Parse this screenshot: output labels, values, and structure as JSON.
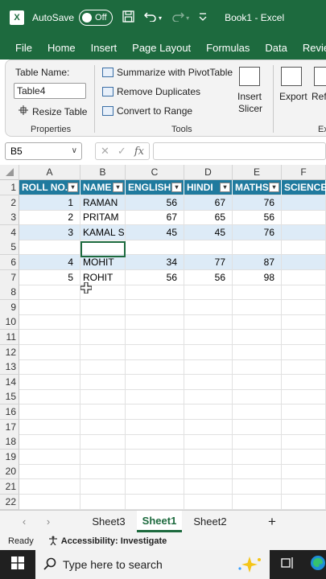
{
  "titlebar": {
    "app_logo": "X",
    "autosave_label": "AutoSave",
    "toggle_state": "Off",
    "title": "Book1 - Excel",
    "icons": [
      "save-icon",
      "undo-icon",
      "redo-icon",
      "customize-icon"
    ]
  },
  "menu": {
    "items": [
      "File",
      "Home",
      "Insert",
      "Page Layout",
      "Formulas",
      "Data",
      "Review"
    ]
  },
  "ribbon": {
    "properties": {
      "table_name_label": "Table Name:",
      "table_name_value": "Table4",
      "resize_label": "Resize Table",
      "group_label": "Properties"
    },
    "tools": {
      "pivot_label": "Summarize with PivotTable",
      "dup_label": "Remove Duplicates",
      "range_label": "Convert to Range",
      "slicer_label_1": "Insert",
      "slicer_label_2": "Slicer",
      "group_label": "Tools"
    },
    "external": {
      "export_label": "Export",
      "refresh_label": "Refr",
      "group_label": "Ex"
    }
  },
  "formula": {
    "namebox": "B5",
    "cancel": "✕",
    "enter": "✓",
    "fx": "fx"
  },
  "grid": {
    "columns": [
      "A",
      "B",
      "C",
      "D",
      "E",
      "F"
    ],
    "rows": [
      "1",
      "2",
      "3",
      "4",
      "5",
      "6",
      "7",
      "8",
      "9",
      "10",
      "11",
      "12",
      "13",
      "14",
      "15",
      "16",
      "17",
      "18",
      "19",
      "20",
      "21",
      "22"
    ],
    "headers": [
      "ROLL NO.",
      "NAME",
      "ENGLISH",
      "HINDI",
      "MATHS",
      "SCIENCE"
    ],
    "data": [
      [
        "1",
        "RAMAN",
        "56",
        "67",
        "76",
        ""
      ],
      [
        "2",
        "PRITAM",
        "67",
        "65",
        "56",
        ""
      ],
      [
        "3",
        "KAMAL SI",
        "45",
        "45",
        "76",
        ""
      ],
      [
        "",
        "",
        "",
        "",
        "",
        ""
      ],
      [
        "4",
        "MOHIT",
        "34",
        "77",
        "87",
        ""
      ],
      [
        "5",
        "ROHIT",
        "56",
        "56",
        "98",
        ""
      ]
    ]
  },
  "sheets": {
    "nav_prev": "‹",
    "nav_next": "›",
    "tabs": [
      "Sheet3",
      "Sheet1",
      "Sheet2"
    ],
    "active": "Sheet1",
    "add": "+"
  },
  "status": {
    "ready": "Ready",
    "accessibility": "Accessibility: Investigate"
  },
  "taskbar": {
    "search_placeholder": "Type here to search"
  },
  "colors": {
    "excel_green": "#1d6a3e",
    "table_header": "#1f7a9e",
    "band": "#ddebf7"
  }
}
